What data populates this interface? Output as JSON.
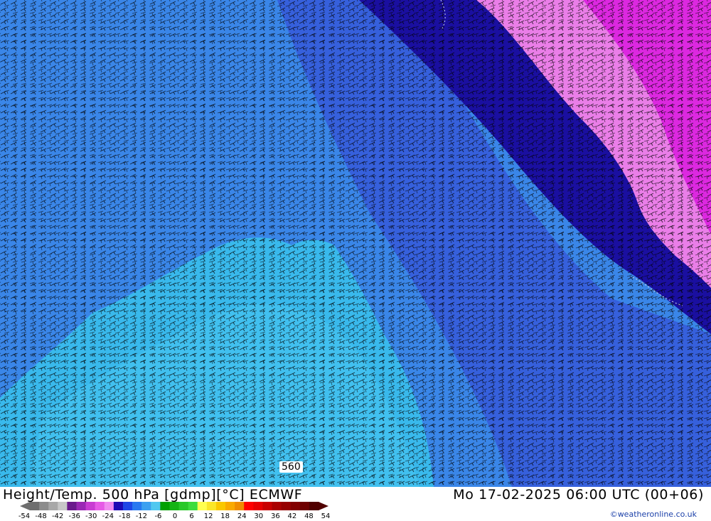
{
  "map": {
    "contour_label": "560",
    "zones": [
      {
        "name": "light-cyan",
        "color": "#39b9ec"
      },
      {
        "name": "medium-blue",
        "color": "#3a86e8"
      },
      {
        "name": "royal-blue",
        "color": "#3660dc"
      },
      {
        "name": "dark-navy",
        "color": "#1a0fa0"
      },
      {
        "name": "violet",
        "color": "#8850dc"
      },
      {
        "name": "pink",
        "color": "#ea7ee8"
      },
      {
        "name": "magenta",
        "color": "#dc28e0"
      }
    ]
  },
  "footer": {
    "title": "Height/Temp. 500 hPa [gdmp][°C] ECMWF",
    "datetime": "Mo 17-02-2025 06:00 UTC (00+06)",
    "credit": "©weatheronline.co.uk"
  },
  "legend": {
    "ticks": [
      "-54",
      "-48",
      "-42",
      "-36",
      "-30",
      "-24",
      "-18",
      "-12",
      "-6",
      "0",
      "6",
      "12",
      "18",
      "24",
      "30",
      "36",
      "42",
      "48",
      "54"
    ],
    "colors": [
      "#6e6e6e",
      "#8c8c8c",
      "#a8a8a8",
      "#c8c8c8",
      "#6a1a8c",
      "#9a28b4",
      "#c83cd2",
      "#e65ae6",
      "#f08cf0",
      "#1e0ab4",
      "#1e46e6",
      "#2878f0",
      "#3ca0f0",
      "#50c8f0",
      "#00a000",
      "#14b414",
      "#28c828",
      "#3cdc3c",
      "#ffff50",
      "#fae628",
      "#fac800",
      "#faaa00",
      "#f08c00",
      "#ff0000",
      "#e60000",
      "#c80000",
      "#aa0000",
      "#960000",
      "#820000",
      "#6e0000",
      "#500000"
    ]
  }
}
